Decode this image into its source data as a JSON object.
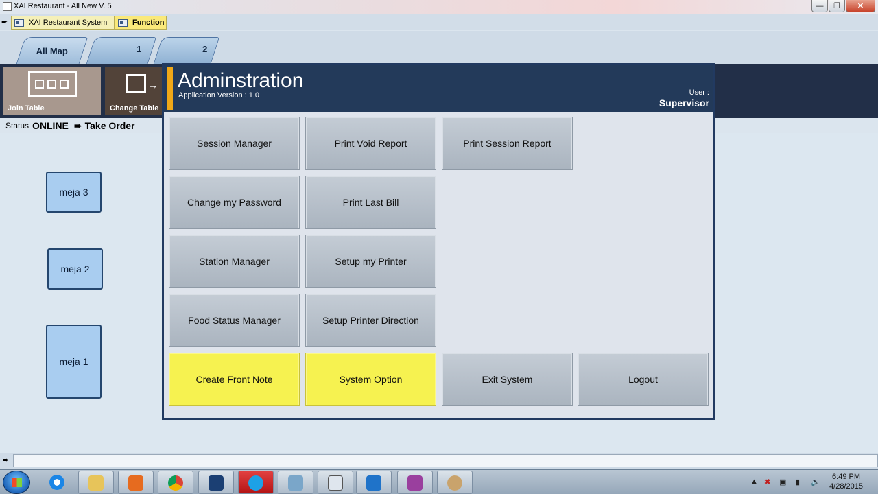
{
  "window": {
    "title": "XAI Restaurant - All New V. 5",
    "controls": [
      "minimize",
      "restore",
      "close"
    ]
  },
  "doc_tabs": [
    {
      "label": "XAI Restaurant System",
      "icon": "window-icon"
    },
    {
      "label": "Function",
      "icon": "window-icon",
      "active": true
    }
  ],
  "map_tabs": [
    {
      "label": "All Map"
    },
    {
      "label": "1"
    },
    {
      "label": "2"
    }
  ],
  "toolbar": {
    "join_table": "Join Table",
    "change_table": "Change Table"
  },
  "status": {
    "label": "Status",
    "value": "ONLINE",
    "take_order": "Take Order"
  },
  "tables": [
    {
      "label": "meja 3"
    },
    {
      "label": "meja 2"
    },
    {
      "label": "meja 1"
    }
  ],
  "dialog": {
    "title": "Adminstration",
    "version": "Application Version : 1.0",
    "user_label": "User :",
    "user": "Supervisor",
    "buttons": {
      "session_manager": "Session Manager",
      "print_void_report": "Print Void Report",
      "print_session_report": "Print Session Report",
      "change_password": "Change my Password",
      "print_last_bill": "Print Last Bill",
      "station_manager": "Station Manager",
      "setup_printer": "Setup my Printer",
      "food_status_manager": "Food Status Manager",
      "setup_printer_direction": "Setup Printer Direction",
      "create_front_note": "Create Front Note",
      "system_option": "System Option",
      "exit_system": "Exit System",
      "logout": "Logout"
    },
    "colors": {
      "header": "#233a5a",
      "accent": "#f0a818",
      "highlight": "#f6f250"
    }
  },
  "taskbar": {
    "apps": [
      "internet-explorer-icon",
      "file-explorer-icon",
      "media-player-icon",
      "chrome-icon",
      "photoshop-icon",
      "skype-icon",
      "app-icon",
      "app-icon",
      "teamviewer-icon",
      "onenote-icon",
      "paint-icon"
    ],
    "time": "6:49 PM",
    "date": "4/28/2015"
  }
}
